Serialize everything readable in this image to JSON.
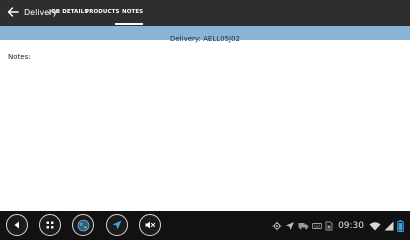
{
  "header": {
    "title": "Delivery",
    "tabs": [
      {
        "label": "JOB DETAILS"
      },
      {
        "label": "PRODUCTS"
      },
      {
        "label": "NOTES"
      }
    ]
  },
  "info_bar": {
    "text": "Delivery: AELL05J02"
  },
  "content": {
    "notes_label": "Notes:"
  },
  "system_bar": {
    "time": "09:30"
  },
  "colors": {
    "appbar": "#2e2e2e",
    "info_bar": "#8ab4d6",
    "system_bar": "#111111",
    "navigate_accent": "#3aa3e3"
  },
  "icons": {
    "back": "arrow-left-icon",
    "nav_back": "triangle-back-icon",
    "nav_home": "grid-icon",
    "nav_maps": "globe-icon",
    "nav_navigate": "navigation-arrow-icon",
    "nav_mute": "speaker-mute-icon"
  }
}
